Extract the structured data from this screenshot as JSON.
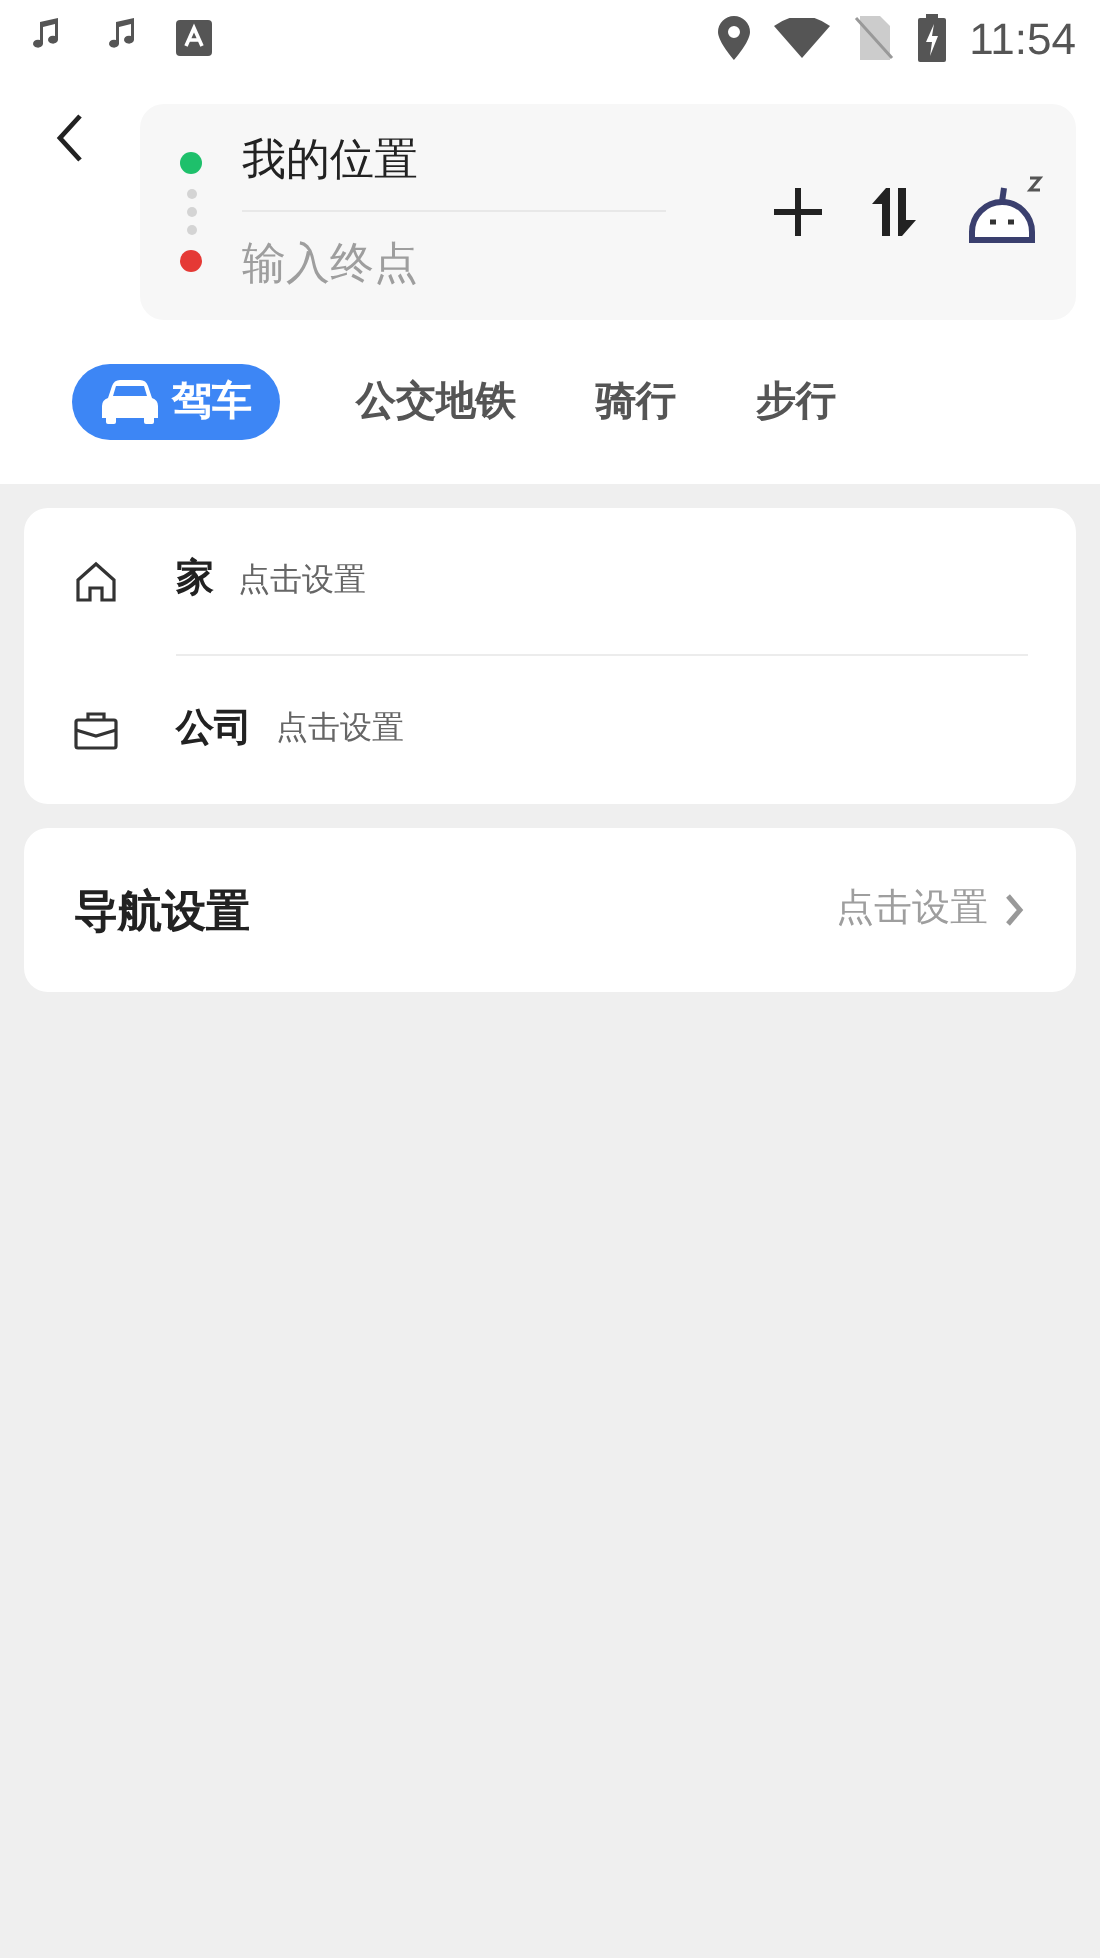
{
  "status_bar": {
    "time": "11:54"
  },
  "route": {
    "origin": {
      "value": "我的位置"
    },
    "destination": {
      "placeholder": "输入终点"
    }
  },
  "tabs": [
    {
      "label": "驾车",
      "selected": true,
      "kind": "car"
    },
    {
      "label": "公交地铁",
      "selected": false
    },
    {
      "label": "骑行",
      "selected": false
    },
    {
      "label": "步行",
      "selected": false
    }
  ],
  "places": [
    {
      "kind": "home",
      "name": "家",
      "action": "点击设置"
    },
    {
      "kind": "work",
      "name": "公司",
      "action": "点击设置"
    }
  ],
  "navigation_settings": {
    "title": "导航设置",
    "action": "点击设置"
  }
}
